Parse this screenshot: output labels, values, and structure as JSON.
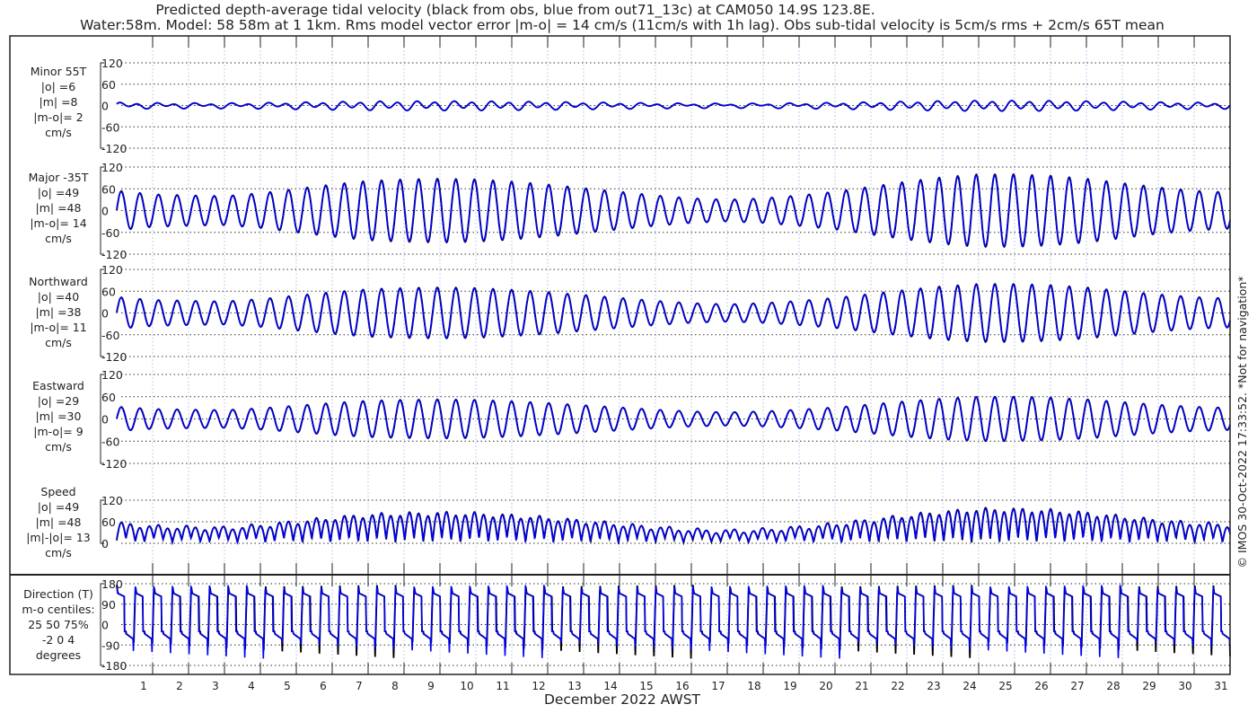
{
  "chart_data": {
    "type": "line",
    "title": "Predicted depth-average tidal velocity (black from obs, blue from out71_13c) at CAM050 14.9S 123.8E.",
    "subtitle": "Water:58m. Model: 58 58m at 1 1km. Rms model vector error |m-o| = 14 cm/s (11cm/s with 1h lag). Obs sub-tidal velocity is 5cm/s rms + 2cm/s 65T mean",
    "xlabel": "December 2022 AWST",
    "x_ticks": [
      "1",
      "2",
      "3",
      "4",
      "5",
      "6",
      "7",
      "8",
      "9",
      "10",
      "11",
      "12",
      "13",
      "14",
      "15",
      "16",
      "17",
      "18",
      "19",
      "20",
      "21",
      "22",
      "23",
      "24",
      "25",
      "26",
      "27",
      "28",
      "29",
      "30",
      "31"
    ],
    "xlim_days": [
      0,
      31
    ],
    "series_colors": {
      "obs": "#000000",
      "model": "#0000ee"
    },
    "legend": "in title",
    "major_amplitude_envelope_by_day": [
      55,
      45,
      42,
      40,
      48,
      60,
      72,
      82,
      86,
      88,
      86,
      80,
      72,
      62,
      52,
      42,
      34,
      30,
      34,
      42,
      52,
      66,
      80,
      92,
      100,
      100,
      96,
      88,
      76,
      64,
      55,
      50
    ],
    "panels": [
      {
        "id": "minor",
        "label": [
          "Minor 55T",
          "|o| =6",
          "|m| =8",
          "|m-o|= 2",
          "cm/s"
        ],
        "ticks": [
          "120",
          "60",
          "0",
          "-60",
          "-120"
        ],
        "ylim": [
          -120,
          120
        ],
        "scale": 0.12
      },
      {
        "id": "major",
        "label": [
          "Major -35T",
          "|o| =49",
          "|m| =48",
          "|m-o|= 14",
          "cm/s"
        ],
        "ticks": [
          "120",
          "60",
          "0",
          "-60",
          "-120"
        ],
        "ylim": [
          -120,
          120
        ],
        "scale": 1.0
      },
      {
        "id": "north",
        "label": [
          "Northward",
          "|o| =40",
          "|m| =38",
          "|m-o|= 11",
          "cm/s"
        ],
        "ticks": [
          "120",
          "60",
          "0",
          "-60",
          "-120"
        ],
        "ylim": [
          -120,
          120
        ],
        "scale": 0.8
      },
      {
        "id": "east",
        "label": [
          "Eastward",
          "|o| =29",
          "|m| =30",
          "|m-o|= 9",
          "cm/s"
        ],
        "ticks": [
          "120",
          "60",
          "0",
          "-60",
          "-120"
        ],
        "ylim": [
          -120,
          120
        ],
        "scale": 0.6
      },
      {
        "id": "speed",
        "label": [
          "Speed",
          "|o| =49",
          "|m| =48",
          "|m|-|o|= 13",
          "cm/s"
        ],
        "ticks": [
          "120",
          "60",
          "0"
        ],
        "ylim": [
          0,
          120
        ],
        "scale": 1.0
      },
      {
        "id": "direction",
        "label": [
          "Direction (T)",
          "m-o centiles:",
          "25  50  75%",
          "-2  0  4",
          "degrees"
        ],
        "ticks": [
          "180",
          "90",
          "0",
          "-90",
          "-180"
        ],
        "ylim": [
          -180,
          180
        ],
        "scale": 1.0
      }
    ],
    "footer_note": "© IMOS 30-Oct-2022 17:33:52. *Not for navigation*"
  }
}
